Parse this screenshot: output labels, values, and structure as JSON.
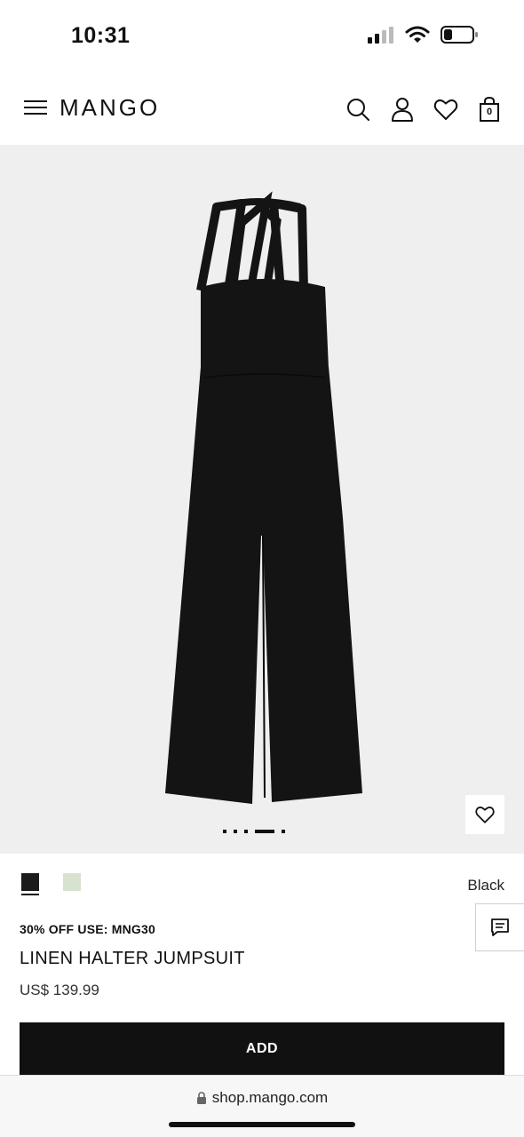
{
  "status_bar": {
    "time": "10:31"
  },
  "header": {
    "logo": "MANGO",
    "bag_count": "0",
    "icons": [
      "menu-icon",
      "search-icon",
      "account-icon",
      "heart-icon",
      "bag-icon"
    ]
  },
  "gallery": {
    "slides": 5,
    "active_slide": 4
  },
  "product": {
    "promo": "30% OFF USE: MNG30",
    "title": "LINEN HALTER JUMPSUIT",
    "price": "US$ 139.99",
    "selected_color": "Black",
    "swatches": [
      {
        "color": "#1b1b1b",
        "selected": true
      },
      {
        "color": "#d7e3cf",
        "selected": false
      }
    ],
    "add_label": "ADD"
  },
  "browser": {
    "url": "shop.mango.com"
  },
  "colors": {
    "accent": "#111111",
    "image_bg": "#efefef",
    "jumpsuit": "#141414"
  }
}
